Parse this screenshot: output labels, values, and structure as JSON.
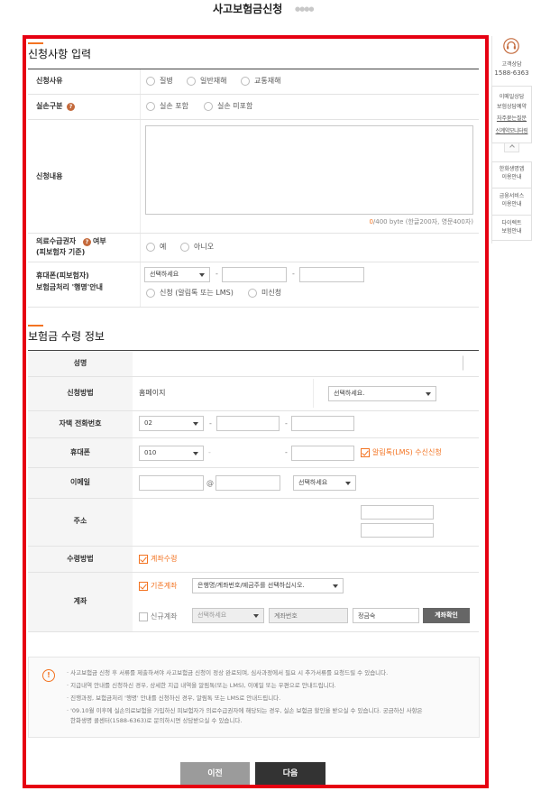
{
  "header": {
    "title": "사고보험금신청",
    "dots": "●●●●"
  },
  "apply": {
    "heading": "신청사항 입력",
    "reason": {
      "label": "신청사유",
      "options": [
        "질병",
        "일반재해",
        "교통재해"
      ]
    },
    "loss": {
      "label": "실손구분",
      "help": "?",
      "options": [
        "실손 포함",
        "실손 미포함"
      ]
    },
    "content": {
      "label": "신청내용",
      "count": "0",
      "limit": "/400 byte (한글200자, 영문400자)"
    },
    "medical_aid": {
      "label": "의료수급권자",
      "help": "?",
      "label_suffix": "여부",
      "label_sub": "(피보험자 기준)",
      "options": [
        "예",
        "아니오"
      ]
    },
    "progress_notice": {
      "label": "휴대폰(피보험자)",
      "label_sub": "보험금처리 '행명'안내",
      "carrier": "선택하세요",
      "separator": "-",
      "options": [
        "신청 (알림톡 또는 LMS)",
        "미신청"
      ]
    }
  },
  "receive": {
    "heading": "보험금 수령 정보",
    "name": {
      "label": "성명"
    },
    "method": {
      "label": "신청방법",
      "value": "홈페이지",
      "select": "선택하세요."
    },
    "home_phone": {
      "label": "자택 전화번호",
      "area": "02",
      "separator": "-"
    },
    "mobile": {
      "label": "휴대폰",
      "prefix": "010",
      "separator": "-",
      "opt_in": "알림톡(LMS) 수신신청",
      "opt_in_checked": true
    },
    "email": {
      "label": "이메일",
      "at": "@",
      "domain_select": "선택하세요"
    },
    "address": {
      "label": "주소"
    },
    "receive_method": {
      "label": "수령방법",
      "option": "계좌수령",
      "checked": true
    },
    "account": {
      "label": "계좌",
      "existing": "기존계좌",
      "existing_checked": true,
      "existing_select": "은행명/계좌번호/예금주를 선택하십시오.",
      "new": "신규계좌",
      "new_checked": false,
      "bank_select": "선택하세요",
      "number_placeholder": "계좌번호",
      "holder": "정금숙",
      "verify": "계좌확인"
    }
  },
  "notice": {
    "icon": "!",
    "lines": [
      "· 사고보험금 신청 후 서류를 제출하셔야 사고보험금 신청이 정상 완료되며, 심사과정에서 필요 시 추가서류를 요청드릴 수 있습니다.",
      "· 지급내역 안내를 신청하신 경우, 상세한 지급 내역을 알림톡(또는 LMS), 이메일 또는 우편으로 안내드립니다.",
      "· 진행과정, 보험금처리 '행명' 안내를 신청하신 경우, 알림톡 또는 LMS로 안내드립니다.",
      "· '09.10월 이후에 실손의료보험을 가입하신 피보험자가 의료수급권자에 해당되는 경우, 실손 보험금 할인을 받으실 수 있습니다. 궁금하신 사항은",
      "한화생명 콜센터(1588-6363)로 문의하시면 상담받으실 수 있습니다."
    ]
  },
  "buttons": {
    "prev": "이전",
    "next": "다음"
  },
  "sidebar": {
    "consult_label": "고객상담",
    "phone": "1588-6363",
    "links": [
      "이메일상담",
      "보험상담예약",
      "자주묻는질문",
      "신계약모니터링"
    ],
    "guides": [
      [
        "한화생명앱",
        "이용안내"
      ],
      [
        "금융서비스",
        "이용안내"
      ],
      [
        "다이렉트",
        "보험안내"
      ]
    ]
  },
  "icons": {
    "help": "question-icon",
    "alert": "alert-icon",
    "consult": "headset-icon",
    "collapse": "chevron-up-icon",
    "dropdown": "caret-down-icon"
  },
  "colors": {
    "accent": "#f37321",
    "frame": "#e60012",
    "help_icon": "#c46a3c",
    "prev_button": "#9b9b9b",
    "next_button": "#333333",
    "verify_button": "#666666"
  }
}
